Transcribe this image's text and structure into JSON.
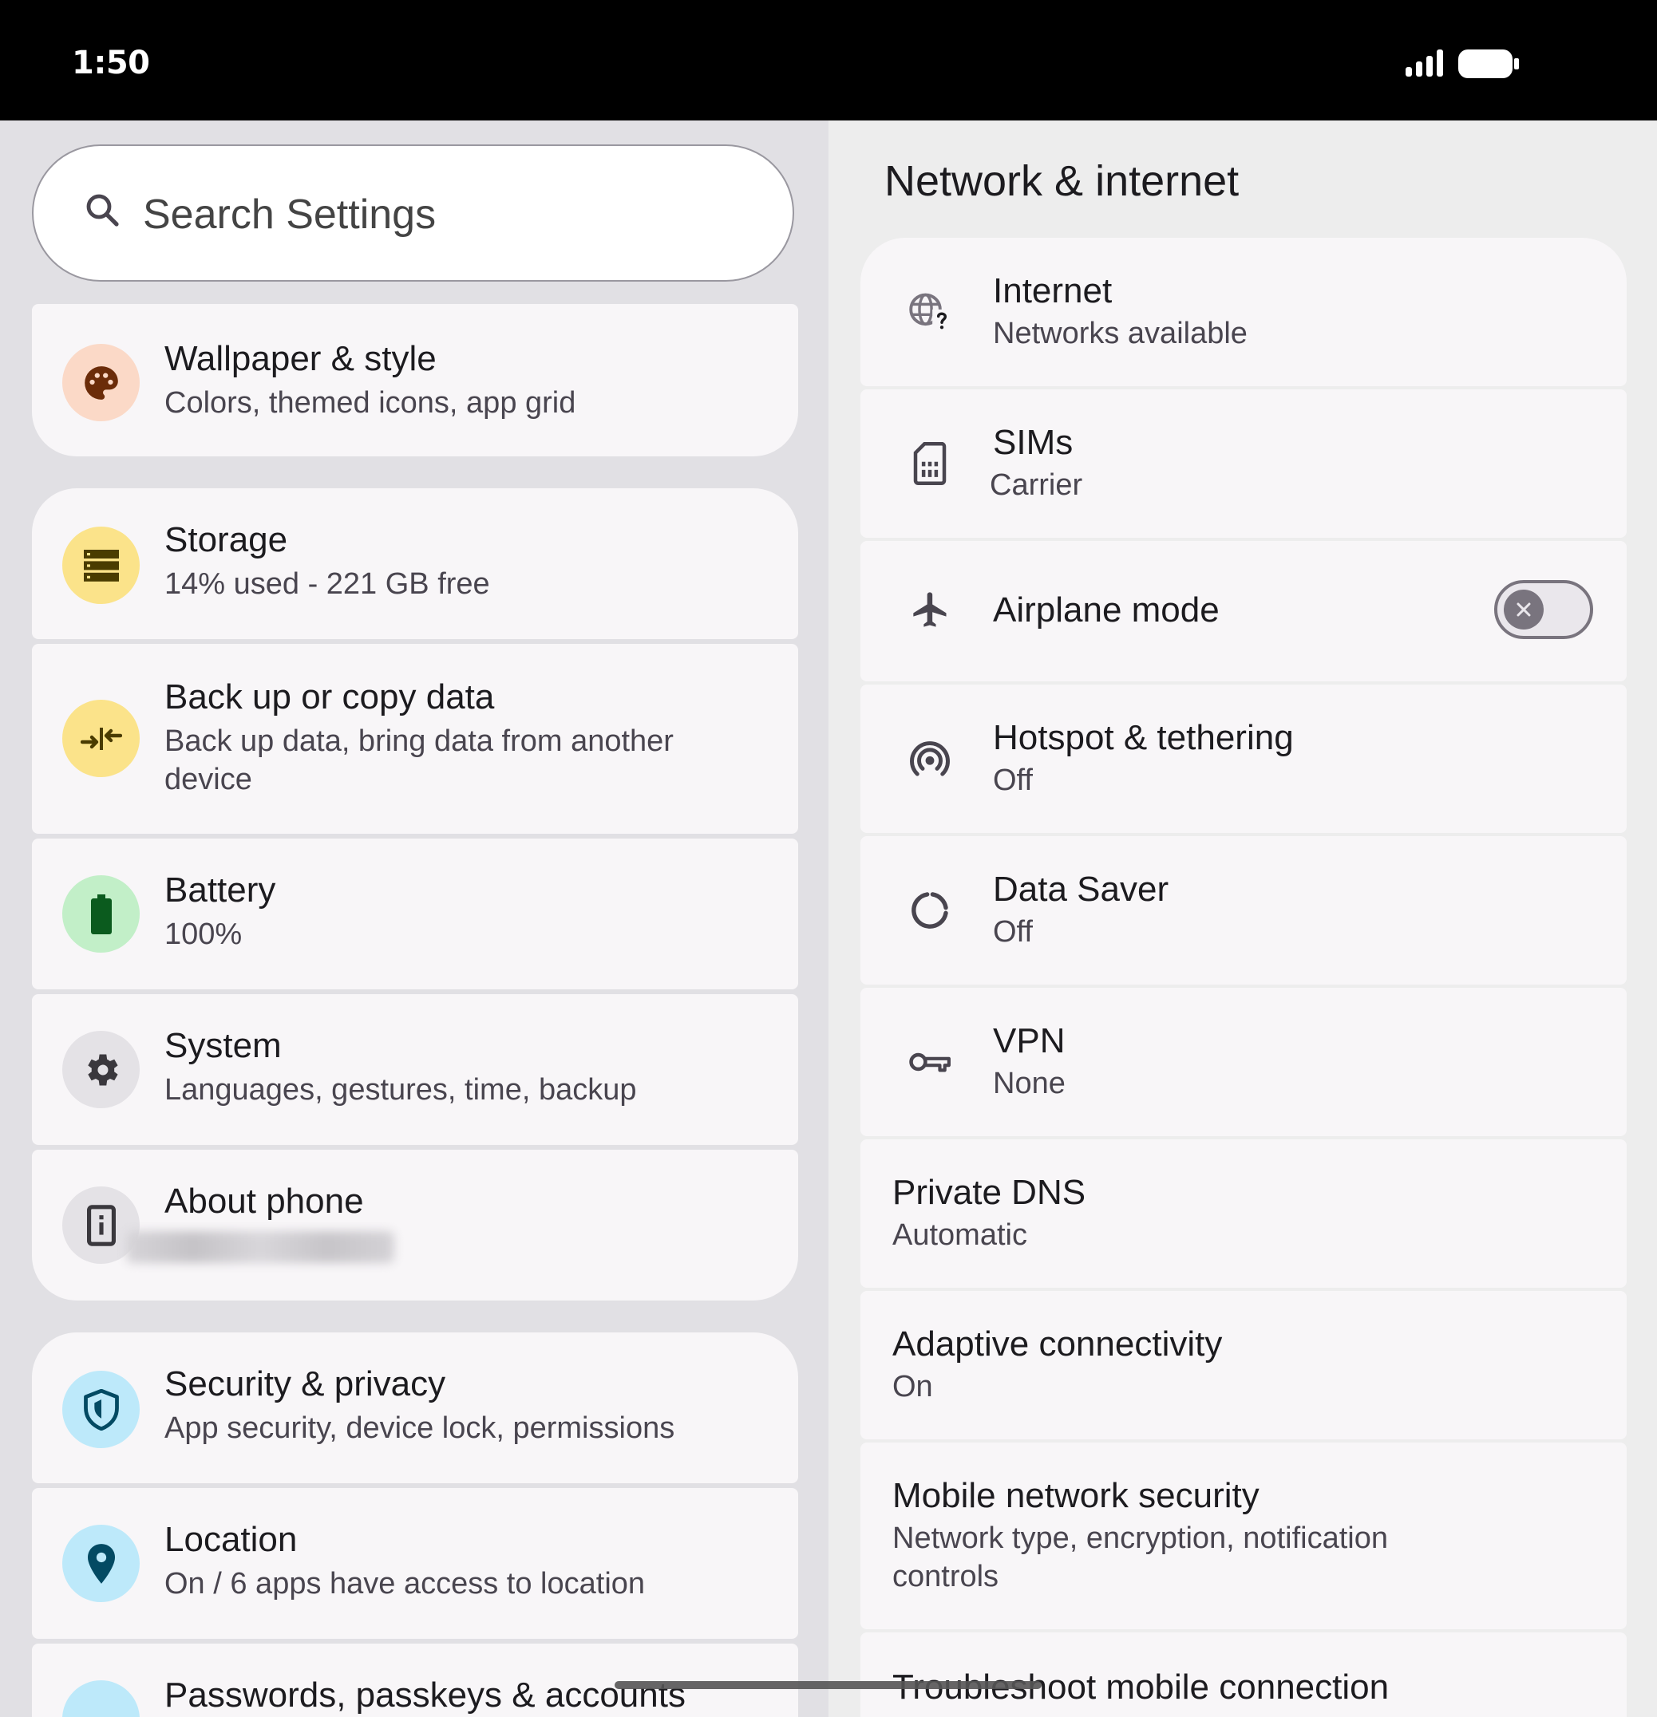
{
  "status_bar": {
    "time": "1:50",
    "signal_icon": "signal-icon",
    "battery_icon": "battery-icon"
  },
  "search": {
    "placeholder": "Search Settings",
    "icon": "search-icon"
  },
  "left_list": {
    "wallpaper": {
      "title": "Wallpaper & style",
      "subtitle": "Colors, themed icons, app grid",
      "icon": "palette-icon",
      "icon_bg": "#fbd9c7",
      "icon_fg": "#6b2c09"
    },
    "storage": {
      "title": "Storage",
      "subtitle": "14% used - 221 GB free",
      "icon": "storage-icon",
      "icon_bg": "#fbe38a",
      "icon_fg": "#4a3c00"
    },
    "backup": {
      "title": "Back up or copy data",
      "subtitle": "Back up data, bring data from another device",
      "icon": "transfer-arrows-icon",
      "icon_bg": "#fbe38a",
      "icon_fg": "#4a3c00"
    },
    "battery": {
      "title": "Battery",
      "subtitle": "100%",
      "icon": "battery-full-icon",
      "icon_bg": "#c2efc8",
      "icon_fg": "#0b5b1e"
    },
    "system": {
      "title": "System",
      "subtitle": "Languages, gestures, time, backup",
      "icon": "gear-icon",
      "icon_bg": "#e4e2e6",
      "icon_fg": "#3a383d"
    },
    "about": {
      "title": "About phone",
      "icon": "phone-info-icon",
      "icon_bg": "#e4e2e6",
      "icon_fg": "#3a383d"
    },
    "security": {
      "title": "Security & privacy",
      "subtitle": "App security, device lock, permissions",
      "icon": "shield-icon",
      "icon_bg": "#bde9fa",
      "icon_fg": "#034a63"
    },
    "location": {
      "title": "Location",
      "subtitle": "On / 6 apps have access to location",
      "icon": "location-pin-icon",
      "icon_bg": "#bde9fa",
      "icon_fg": "#034a63"
    },
    "passwords": {
      "title": "Passwords, passkeys & accounts",
      "icon": "key-icon",
      "icon_bg": "#bde9fa",
      "icon_fg": "#034a63"
    }
  },
  "right_pane": {
    "title": "Network & internet",
    "internet": {
      "title": "Internet",
      "subtitle": "Networks available",
      "icon": "globe-question-icon"
    },
    "sims": {
      "title": "SIMs",
      "subtitle": "Carrier",
      "icon": "sim-card-icon"
    },
    "airplane": {
      "title": "Airplane mode",
      "icon": "airplane-icon",
      "toggle_state": "off"
    },
    "hotspot": {
      "title": "Hotspot & tethering",
      "subtitle": "Off",
      "icon": "hotspot-icon"
    },
    "datasaver": {
      "title": "Data Saver",
      "subtitle": "Off",
      "icon": "data-saver-icon"
    },
    "vpn": {
      "title": "VPN",
      "subtitle": "None",
      "icon": "vpn-key-icon"
    },
    "private_dns": {
      "title": "Private DNS",
      "subtitle": "Automatic"
    },
    "adaptive": {
      "title": "Adaptive connectivity",
      "subtitle": "On"
    },
    "mobile_security": {
      "title": "Mobile network security",
      "subtitle": "Network type, encryption, notification controls"
    },
    "troubleshoot": {
      "title": "Troubleshoot mobile connection"
    }
  }
}
